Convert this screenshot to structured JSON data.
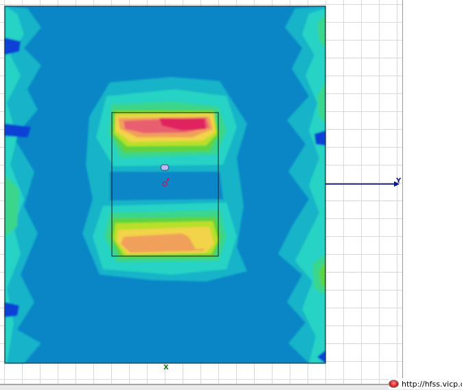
{
  "app": {
    "name": "HFSS"
  },
  "axes": {
    "y_label": "Y",
    "x_label": "X"
  },
  "field_plot": {
    "colormap": [
      "#0a3fd4",
      "#0a86c7",
      "#14b3c9",
      "#27d3c4",
      "#3ad58c",
      "#5fd43f",
      "#b8e02a",
      "#f2d34a",
      "#f0a05a",
      "#e86070",
      "#e0245f"
    ],
    "background_color": "#0a86c7"
  },
  "watermark": {
    "text": "http://hfss.vicp.cc"
  }
}
